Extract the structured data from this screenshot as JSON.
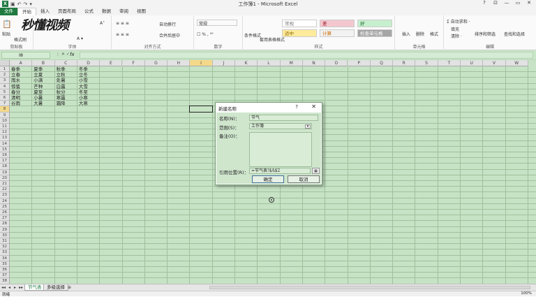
{
  "window": {
    "title": "工作簿1 - Microsoft Excel",
    "controls": [
      "?",
      "⊡",
      "—",
      "▭",
      "✕"
    ]
  },
  "quick_access": {
    "logo": "X",
    "undo": "↶",
    "redo": "↷"
  },
  "tabs": [
    {
      "label": "文件"
    },
    {
      "label": "开始"
    },
    {
      "label": "插入"
    },
    {
      "label": "页面布局"
    },
    {
      "label": "公式"
    },
    {
      "label": "数据"
    },
    {
      "label": "审阅"
    },
    {
      "label": "视图"
    }
  ],
  "ribbon": {
    "paste": "粘贴",
    "cut_format": "格式刷",
    "clipboard_group": "剪贴板",
    "font_group": "字体",
    "align_group": "对齐方式",
    "number_group": "数字",
    "styles_group": "样式",
    "cells_group": "单元格",
    "editing_group": "编辑",
    "wrap_text": "自动换行",
    "merge_center": "合并后居中",
    "number_format": "常规",
    "cond_format": "条件格式",
    "table_format": "套用表格格式",
    "style_cells": [
      {
        "label": "常规"
      },
      {
        "label": "差"
      },
      {
        "label": "好"
      },
      {
        "label": "适中"
      },
      {
        "label": "计算"
      },
      {
        "label": "检查单元格"
      }
    ],
    "insert": "插入",
    "delete": "删除",
    "format": "格式",
    "autosum": "Σ 自动求和 ·",
    "fill": "填充",
    "clear": "清除 ·",
    "sort_filter": "排序和筛选",
    "find_select": "查找和选择"
  },
  "watermark": "秒懂视频",
  "formula_bar": {
    "name_box": "I8",
    "fx": "fx",
    "formula": ""
  },
  "sheet": {
    "columns": [
      "A",
      "B",
      "C",
      "D",
      "E",
      "F",
      "G",
      "H",
      "I",
      "J",
      "K",
      "L",
      "M",
      "N",
      "O",
      "P",
      "Q",
      "R",
      "S",
      "T",
      "U",
      "V",
      "W"
    ],
    "selected_col": "I",
    "selected_row": "8",
    "rows": [
      "1",
      "2",
      "3",
      "4",
      "5",
      "6",
      "7",
      "8",
      "9",
      "10",
      "11",
      "12",
      "13",
      "14",
      "15",
      "16",
      "17",
      "18",
      "19",
      "20",
      "21",
      "22",
      "23",
      "24",
      "25",
      "26",
      "27",
      "28",
      "29",
      "30",
      "31",
      "32",
      "33",
      "34",
      "35",
      "36",
      "37",
      "38"
    ],
    "data": [
      [
        "春季",
        "夏季",
        "秋季",
        "冬季"
      ],
      [
        "立春",
        "立夏",
        "立秋",
        "立冬"
      ],
      [
        "雨水",
        "小满",
        "处暑",
        "小雪"
      ],
      [
        "惊蛰",
        "芒种",
        "白露",
        "大雪"
      ],
      [
        "春分",
        "夏至",
        "秋分",
        "冬至"
      ],
      [
        "清明",
        "小暑",
        "寒露",
        "小寒"
      ],
      [
        "谷雨",
        "大暑",
        "霜降",
        "大寒"
      ]
    ]
  },
  "sheet_tabs": {
    "nav": [
      "◂◂",
      "◂",
      "▸",
      "▸▸"
    ],
    "tabs": [
      {
        "label": "节气表",
        "active": true
      },
      {
        "label": "多级选择",
        "active": false
      }
    ],
    "new_icon": "⊕"
  },
  "status": {
    "left": "就绪",
    "right": "100%"
  },
  "dialog": {
    "title": "新建名称",
    "help": "?",
    "close": "✕",
    "name_label": "名称(N)：",
    "name_value": "节气",
    "scope_label": "范围(S)：",
    "scope_value": "工作簿",
    "comment_label": "备注(O)：",
    "ref_label": "引用位置(R)：",
    "ref_value": "=节气表!$A$2",
    "ok": "确定",
    "cancel": "取消"
  }
}
